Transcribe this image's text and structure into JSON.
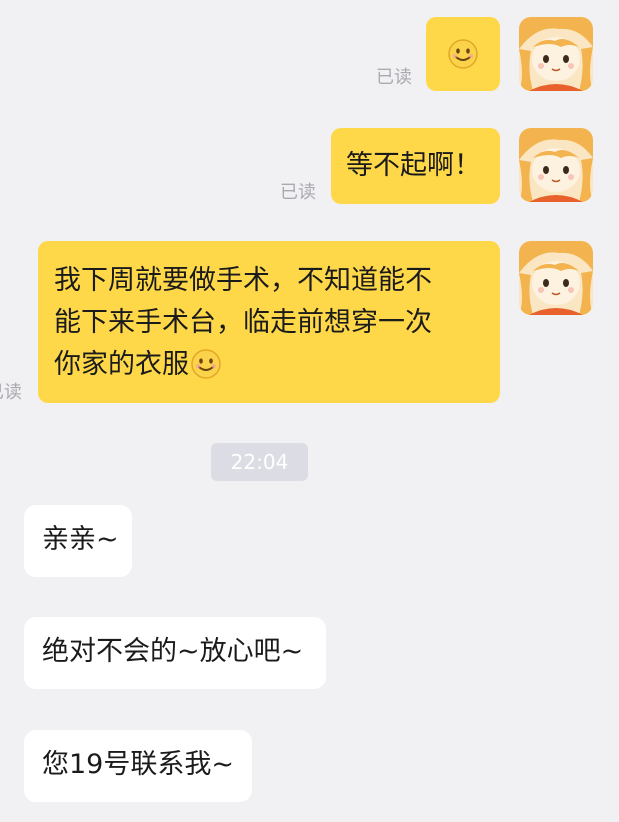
{
  "messages": {
    "m1": {
      "read": "已读",
      "emoji": "smiling-face"
    },
    "m2": {
      "read": "已读",
      "text": "等不起啊！"
    },
    "m3": {
      "read": "已读",
      "lines": [
        "我下周就要做手术，不知道能不",
        "能下来手术台，临走前想穿一次",
        "你家的衣服"
      ],
      "emoji": "smiling-face"
    },
    "timestamp": "22:04",
    "m4": {
      "text": "亲亲~"
    },
    "m5": {
      "text": "绝对不会的~放心吧~"
    },
    "m6": {
      "text": "您19号联系我~"
    }
  },
  "colors": {
    "background": "#f1f1f4",
    "outgoing_bubble": "#ffd84a",
    "incoming_bubble": "#ffffff",
    "read_text": "#a9a9b0"
  },
  "avatar_icon": "anime-girl-avatar"
}
